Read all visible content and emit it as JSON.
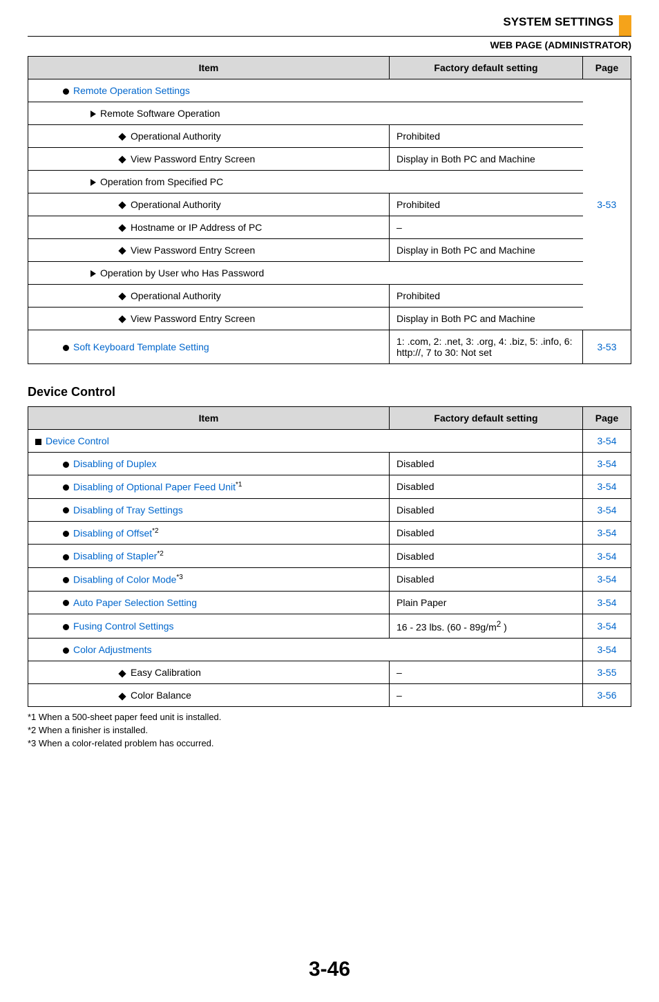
{
  "header": {
    "section": "SYSTEM SETTINGS",
    "subhead": "WEB PAGE (ADMINISTRATOR)"
  },
  "table1": {
    "headers": {
      "item": "Item",
      "fds": "Factory default setting",
      "page": "Page"
    },
    "rows": [
      {
        "bullet": "circle",
        "indent": 1,
        "label": "Remote Operation Settings",
        "link": true,
        "span": true
      },
      {
        "bullet": "tri",
        "indent": 2,
        "label": "Remote Software Operation",
        "span": true
      },
      {
        "bullet": "diamond",
        "indent": 3,
        "label": "Operational Authority",
        "fds": "Prohibited"
      },
      {
        "bullet": "diamond",
        "indent": 3,
        "label": "View Password Entry Screen",
        "fds": "Display in Both PC and Machine"
      },
      {
        "bullet": "tri",
        "indent": 2,
        "label": "Operation from Specified PC",
        "span": true
      },
      {
        "bullet": "diamond",
        "indent": 3,
        "label": "Operational Authority",
        "fds": "Prohibited"
      },
      {
        "bullet": "diamond",
        "indent": 3,
        "label": "Hostname or IP Address of PC",
        "fds": "–"
      },
      {
        "bullet": "diamond",
        "indent": 3,
        "label": "View Password Entry Screen",
        "fds": "Display in Both PC and Machine"
      },
      {
        "bullet": "tri",
        "indent": 2,
        "label": "Operation by User who Has Password",
        "span": true
      },
      {
        "bullet": "diamond",
        "indent": 3,
        "label": "Operational Authority",
        "fds": "Prohibited"
      },
      {
        "bullet": "diamond",
        "indent": 3,
        "label": "View Password Entry Screen",
        "fds": "Display in Both PC and Machine"
      },
      {
        "bullet": "circle",
        "indent": 1,
        "label": "Soft Keyboard Template Setting",
        "link": true,
        "fds": "1: .com, 2: .net, 3: .org, 4: .biz, 5: .info, 6: http://, 7 to 30: Not set",
        "page": "3-53"
      }
    ],
    "groupPage": "3-53"
  },
  "table2": {
    "title": "Device Control",
    "headers": {
      "item": "Item",
      "fds": "Factory default setting",
      "page": "Page"
    },
    "rows": [
      {
        "bullet": "square",
        "indent": 0,
        "label": "Device Control",
        "link": true,
        "span": true,
        "page": "3-54"
      },
      {
        "bullet": "circle",
        "indent": 1,
        "label": "Disabling of Duplex",
        "link": true,
        "fds": "Disabled",
        "page": "3-54"
      },
      {
        "bullet": "circle",
        "indent": 1,
        "label": "Disabling of Optional Paper Feed Unit",
        "link": true,
        "sup": "*1",
        "fds": "Disabled",
        "page": "3-54"
      },
      {
        "bullet": "circle",
        "indent": 1,
        "label": "Disabling of Tray Settings",
        "link": true,
        "fds": "Disabled",
        "page": "3-54"
      },
      {
        "bullet": "circle",
        "indent": 1,
        "label": "Disabling of Offset",
        "link": true,
        "sup": "*2",
        "fds": "Disabled",
        "page": "3-54"
      },
      {
        "bullet": "circle",
        "indent": 1,
        "label": "Disabling of Stapler",
        "link": true,
        "sup": "*2",
        "fds": "Disabled",
        "page": "3-54"
      },
      {
        "bullet": "circle",
        "indent": 1,
        "label": "Disabling of Color Mode",
        "link": true,
        "sup": "*3",
        "fds": "Disabled",
        "page": "3-54"
      },
      {
        "bullet": "circle",
        "indent": 1,
        "label": "Auto Paper Selection Setting",
        "link": true,
        "fds": "Plain Paper",
        "page": "3-54"
      },
      {
        "bullet": "circle",
        "indent": 1,
        "label": "Fusing Control Settings",
        "link": true,
        "fds_html": "16 - 23 lbs. (60 - 89g/m<sup>2</sup> )",
        "page": "3-54"
      },
      {
        "bullet": "circle",
        "indent": 1,
        "label": "Color Adjustments",
        "link": true,
        "span": true,
        "page": "3-54"
      },
      {
        "bullet": "diamond",
        "indent": 3,
        "label": "Easy Calibration",
        "fds": "–",
        "page": "3-55"
      },
      {
        "bullet": "diamond",
        "indent": 3,
        "label": "Color Balance",
        "fds": "–",
        "page": "3-56"
      }
    ]
  },
  "footnotes": [
    "*1  When a 500-sheet paper feed unit is installed.",
    "*2  When a finisher is installed.",
    "*3  When a color-related problem has occurred."
  ],
  "pageNumber": "3-46"
}
